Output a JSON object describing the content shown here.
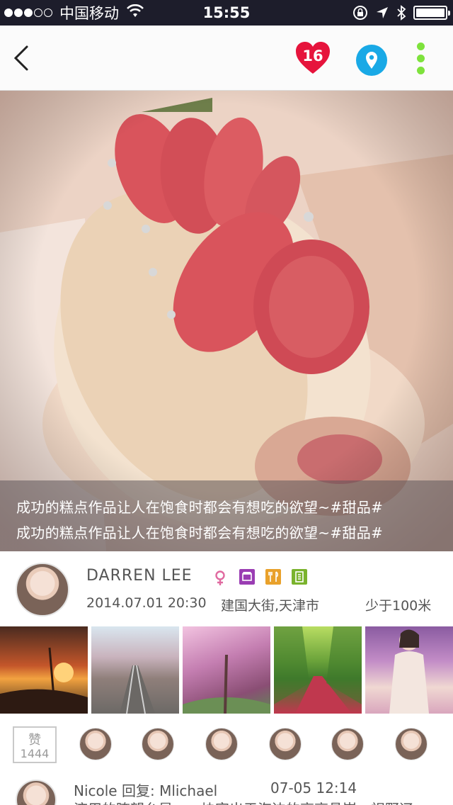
{
  "status_bar": {
    "carrier": "中国移动",
    "time": "15:55",
    "signal_bars": 3
  },
  "nav": {
    "back_icon": "chevron-left-icon",
    "heart_count": "16",
    "colors": {
      "heart": "#e6143c",
      "pin": "#19a9e6",
      "more": "#7ee23c"
    }
  },
  "post": {
    "caption_line1": "成功的糕点作品让人在饱食时都会有想吃的欲望~#甜品#",
    "caption_line2": "成功的糕点作品让人在饱食时都会有想吃的欲望~#甜品#"
  },
  "author": {
    "name": "DARREN LEE",
    "date": "2014.07.01 20:30",
    "place": "建国大街,天津市",
    "distance": "少于100米",
    "tag_colors": [
      "#9a3db3",
      "#e9a12b",
      "#7ab32d"
    ]
  },
  "likes": {
    "label": "赞",
    "count": "1444"
  },
  "comment": {
    "header": "Nicole 回复: Mlichael",
    "time": "07-05  12:14",
    "text": "济用的瞭望台是，一块突出于海边的高高悬崖，视野辽"
  }
}
